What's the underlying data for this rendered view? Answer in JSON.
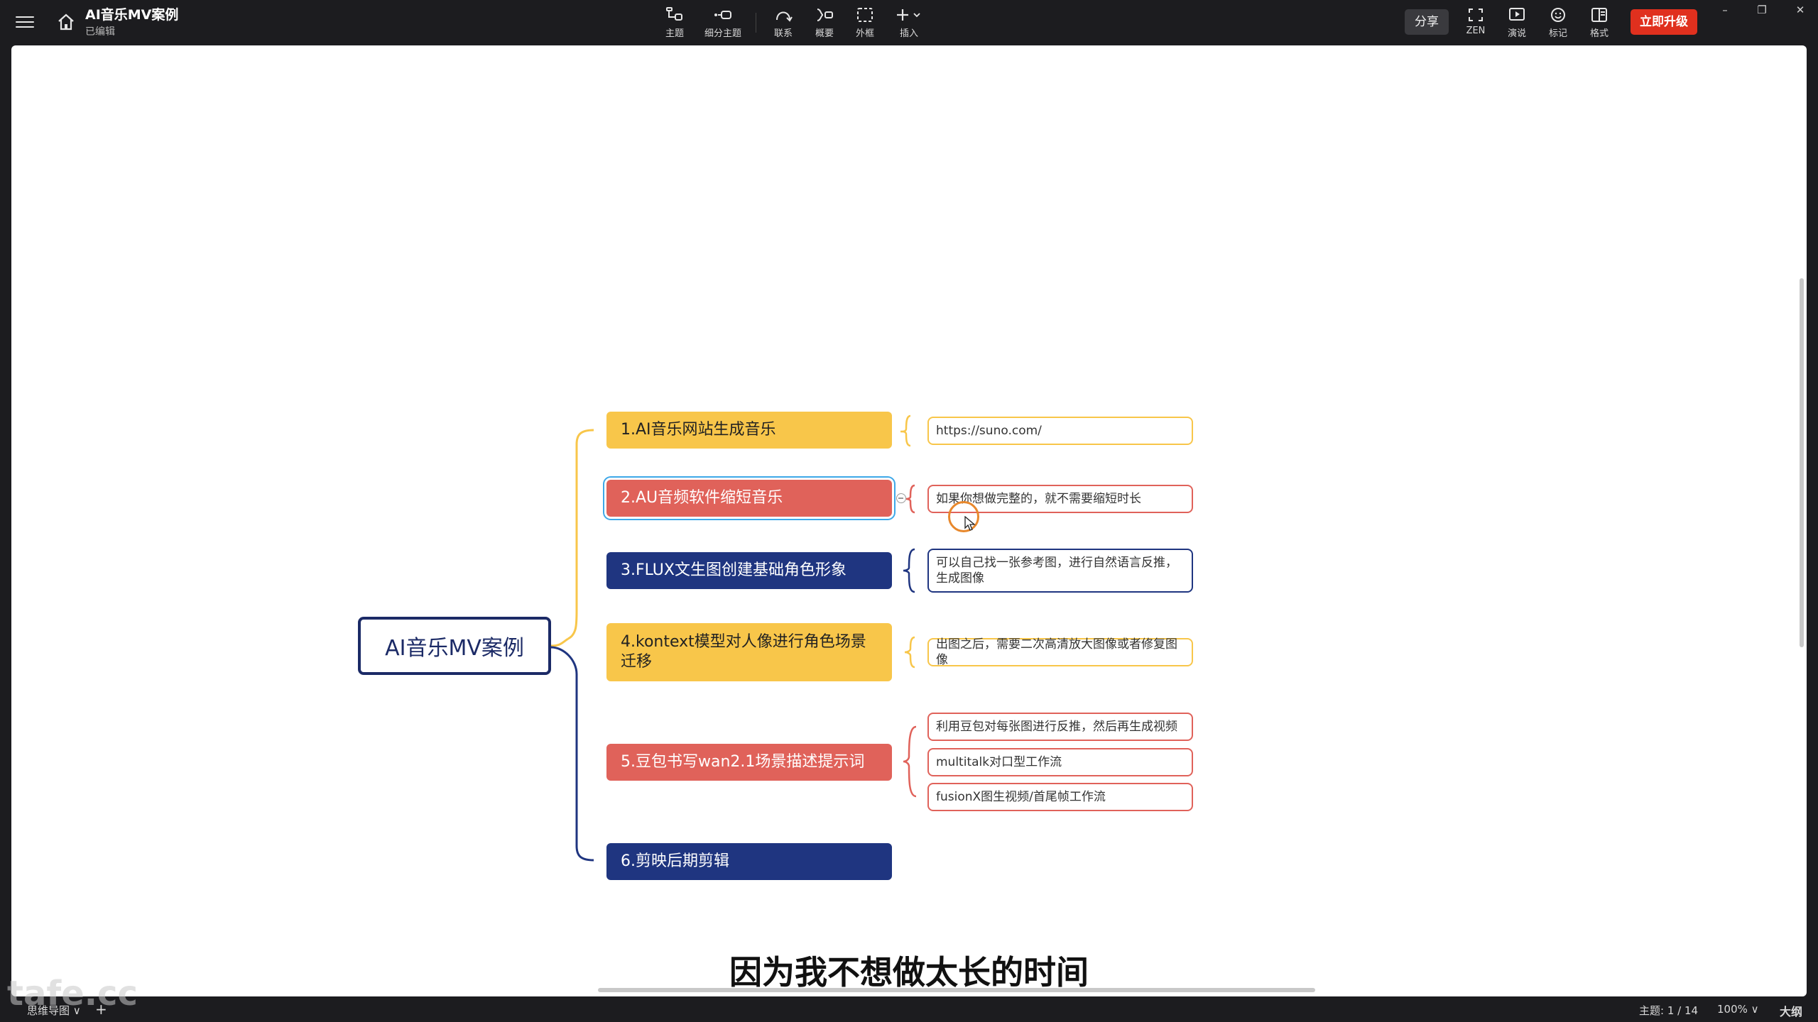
{
  "app": {
    "title": "AI音乐MV案例",
    "status": "已编辑"
  },
  "toolbar": {
    "tools": [
      {
        "label": "主题",
        "icon": "topic-icon"
      },
      {
        "label": "细分主题",
        "icon": "subtopic-icon"
      },
      {
        "label": "联系",
        "icon": "relationship-icon"
      },
      {
        "label": "概要",
        "icon": "summary-icon"
      },
      {
        "label": "外框",
        "icon": "boundary-icon"
      },
      {
        "label": "插入",
        "icon": "insert-icon"
      }
    ],
    "share_label": "分享",
    "right_tools": [
      {
        "label": "ZEN",
        "icon": "fullscreen-icon"
      },
      {
        "label": "演说",
        "icon": "present-icon"
      },
      {
        "label": "标记",
        "icon": "emoji-icon"
      },
      {
        "label": "格式",
        "icon": "format-panel-icon"
      }
    ],
    "upgrade_label": "立即升级"
  },
  "window_controls": {
    "minimize": "–",
    "restore": "❐",
    "close": "✕"
  },
  "colors": {
    "yellow": "#f8c64a",
    "red": "#e0625a",
    "navy": "#1f3580",
    "root_border": "#1b2a66",
    "upgrade": "#e0301e"
  },
  "mindmap": {
    "root": "AI音乐MV案例",
    "topics": [
      {
        "label": "1.AI音乐网站生成音乐",
        "color": "yellow",
        "notes": [
          "https://suno.com/"
        ]
      },
      {
        "label": "2.AU音频软件缩短音乐",
        "color": "red",
        "selected": true,
        "notes": [
          "如果你想做完整的，就不需要缩短时长"
        ]
      },
      {
        "label": "3.FLUX文生图创建基础角色形象",
        "color": "navy",
        "notes": [
          "可以自己找一张参考图，进行自然语言反推，生成图像"
        ]
      },
      {
        "label": "4.kontext模型对人像进行角色场景迁移",
        "color": "yellow",
        "notes": [
          "出图之后，需要二次高清放大图像或者修复图像"
        ]
      },
      {
        "label": "5.豆包书写wan2.1场景描述提示词",
        "color": "red",
        "notes": [
          "利用豆包对每张图进行反推，然后再生成视频",
          "multitalk对口型工作流",
          "fusionX图生视频/首尾帧工作流"
        ]
      },
      {
        "label": "6.剪映后期剪辑",
        "color": "navy",
        "notes": []
      }
    ]
  },
  "subtitle": "因为我不想做太长的时间",
  "statusbar": {
    "sheet_tab": "思维导图 ∨",
    "add_sheet": "+",
    "topic_count": "主题: 1 / 14",
    "zoom": "100% ∨",
    "outline": "大纲"
  },
  "watermark": "tafe.cc"
}
